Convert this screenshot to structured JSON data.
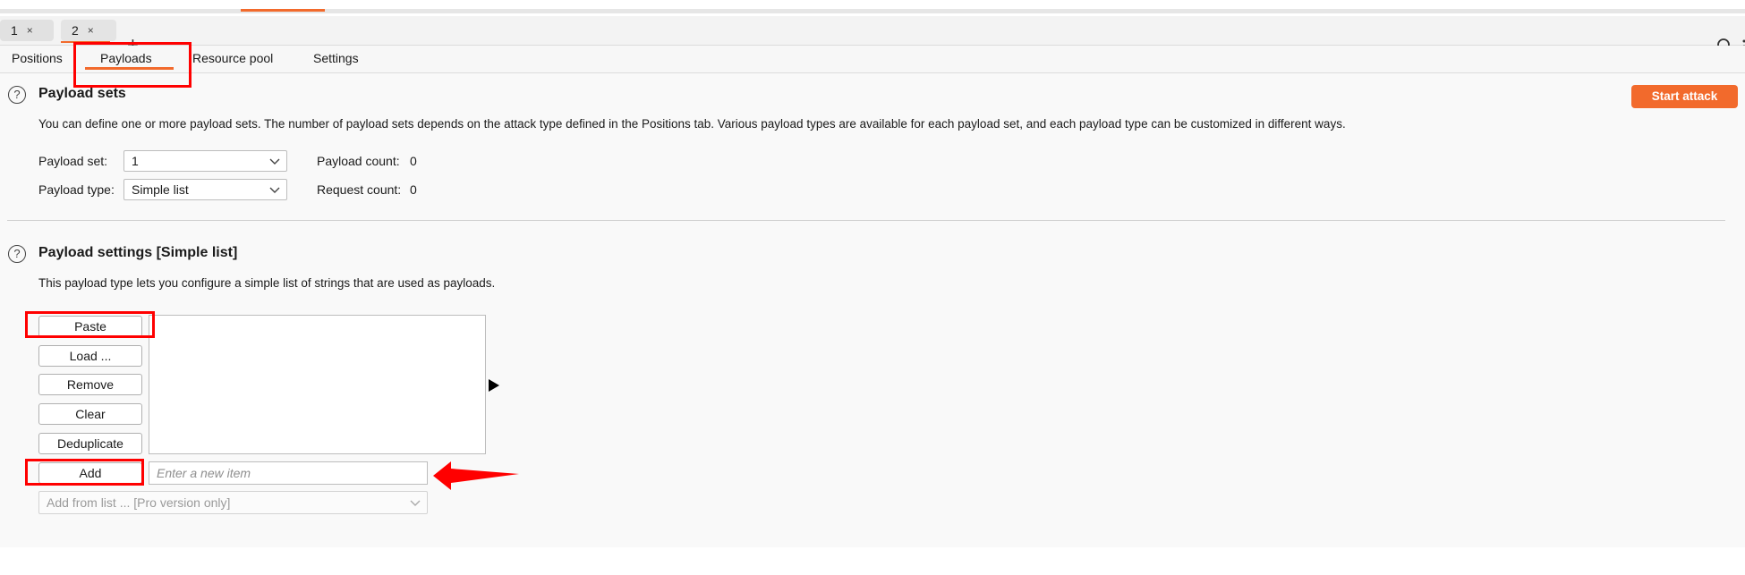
{
  "instance_tabs": [
    {
      "label": "1",
      "close": "×"
    },
    {
      "label": "2",
      "close": "×"
    }
  ],
  "add_tab": "+",
  "sub_tabs": [
    "Positions",
    "Payloads",
    "Resource pool",
    "Settings"
  ],
  "active_sub_tab": "Payloads",
  "payload_sets": {
    "help": "?",
    "title": "Payload sets",
    "description": "You can define one or more payload sets. The number of payload sets depends on the attack type defined in the Positions tab. Various payload types are available for each payload set, and each payload type can be customized in different ways.",
    "payload_set_label": "Payload set:",
    "payload_set_value": "1",
    "payload_type_label": "Payload type:",
    "payload_type_value": "Simple list",
    "payload_count_label": "Payload count:",
    "payload_count_value": "0",
    "request_count_label": "Request count:",
    "request_count_value": "0"
  },
  "start_attack": "Start attack",
  "payload_settings": {
    "help": "?",
    "title": "Payload settings [Simple list]",
    "description": "This payload type lets you configure a simple list of strings that are used as payloads.",
    "buttons": {
      "paste": "Paste",
      "load": "Load ...",
      "remove": "Remove",
      "clear": "Clear",
      "deduplicate": "Deduplicate",
      "add": "Add"
    },
    "new_item_placeholder": "Enter a new item",
    "add_from_list": "Add from list ... [Pro version only]"
  },
  "colors": {
    "accent": "#f26a2c",
    "highlight": "#ff0000"
  },
  "icons": [
    "search-icon",
    "more-icon",
    "help-icon",
    "chevron-down-icon",
    "play-icon",
    "arrow-icon"
  ]
}
